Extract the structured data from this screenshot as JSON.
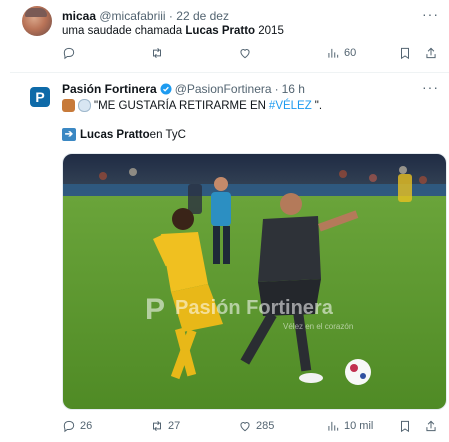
{
  "tweet1": {
    "display_name": "micaa",
    "handle": "@micafabriii",
    "separator": "·",
    "date": "22 de dez",
    "text_prefix": "uma saudade chamada ",
    "text_bold": "Lucas Pratto",
    "text_suffix": " 2015",
    "more": "···",
    "actions": {
      "replies": "",
      "retweets": "",
      "likes": "",
      "views": "60"
    }
  },
  "tweet2": {
    "avatar_letter": "P",
    "display_name": "Pasión Fortinera",
    "handle": "@PasionFortinera",
    "separator": "·",
    "time": "16 h",
    "more": "···",
    "quote_text": "\"ME GUSTARÍA RETIRARME EN ",
    "hashtag": "#VÉLEZ",
    "quote_end": "\".",
    "link_prefix_bold": "Lucas Pratto",
    "link_suffix": " en TyC",
    "image_watermark": "Pasión Fortinera",
    "image_watermark_sub": "Vélez en el corazón",
    "actions": {
      "replies": "26",
      "retweets": "27",
      "likes": "285",
      "views": "10 mil"
    }
  },
  "colors": {
    "accent": "#1d9bf0",
    "muted": "#536471",
    "pitch": "#5b9a2e"
  },
  "icons": [
    "reply-icon",
    "retweet-icon",
    "like-icon",
    "views-icon",
    "bookmark-icon",
    "share-icon",
    "verified-badge-icon",
    "arrow-right-icon",
    "more-icon"
  ]
}
